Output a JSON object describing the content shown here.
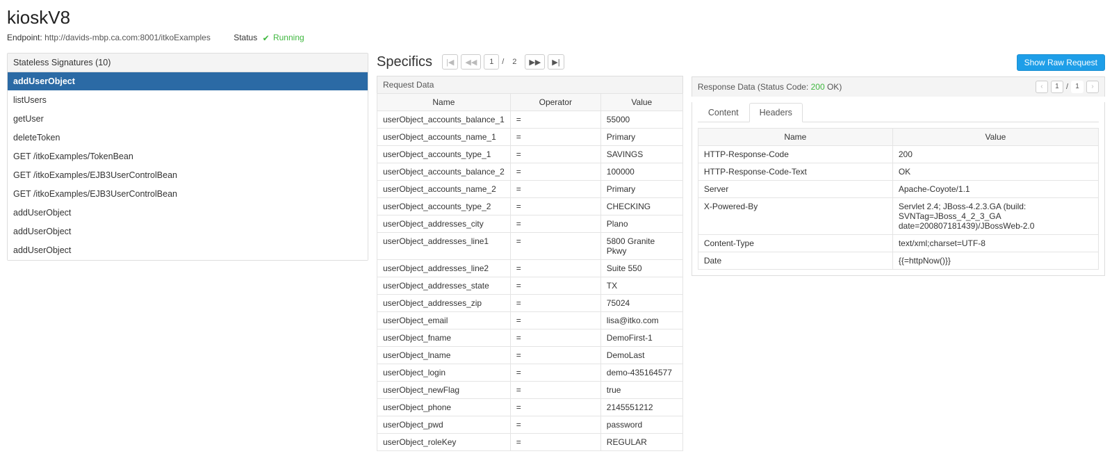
{
  "page_title": "kioskV8",
  "endpoint_label": "Endpoint:",
  "endpoint_value": "http://davids-mbp.ca.com:8001/itkoExamples",
  "status_label": "Status",
  "status_value": "Running",
  "signatures": {
    "header": "Stateless Signatures (10)",
    "items": [
      "addUserObject",
      "listUsers",
      "getUser",
      "deleteToken",
      "GET /itkoExamples/TokenBean",
      "GET /itkoExamples/EJB3UserControlBean",
      "GET /itkoExamples/EJB3UserControlBean",
      "addUserObject",
      "addUserObject",
      "addUserObject"
    ],
    "selected_index": 0
  },
  "specifics": {
    "title": "Specifics",
    "pager": {
      "current": "1",
      "total": "2"
    }
  },
  "raw_button": "Show Raw Request",
  "request": {
    "header": "Request Data",
    "columns": [
      "Name",
      "Operator",
      "Value"
    ],
    "rows": [
      {
        "name": "userObject_accounts_balance_1",
        "op": "=",
        "val": "55000"
      },
      {
        "name": "userObject_accounts_name_1",
        "op": "=",
        "val": "Primary"
      },
      {
        "name": "userObject_accounts_type_1",
        "op": "=",
        "val": "SAVINGS"
      },
      {
        "name": "userObject_accounts_balance_2",
        "op": "=",
        "val": "100000"
      },
      {
        "name": "userObject_accounts_name_2",
        "op": "=",
        "val": "Primary"
      },
      {
        "name": "userObject_accounts_type_2",
        "op": "=",
        "val": "CHECKING"
      },
      {
        "name": "userObject_addresses_city",
        "op": "=",
        "val": "Plano"
      },
      {
        "name": "userObject_addresses_line1",
        "op": "=",
        "val": "5800 Granite Pkwy"
      },
      {
        "name": "userObject_addresses_line2",
        "op": "=",
        "val": "Suite 550"
      },
      {
        "name": "userObject_addresses_state",
        "op": "=",
        "val": "TX"
      },
      {
        "name": "userObject_addresses_zip",
        "op": "=",
        "val": "75024"
      },
      {
        "name": "userObject_email",
        "op": "=",
        "val": "lisa@itko.com"
      },
      {
        "name": "userObject_fname",
        "op": "=",
        "val": "DemoFirst-1"
      },
      {
        "name": "userObject_lname",
        "op": "=",
        "val": "DemoLast"
      },
      {
        "name": "userObject_login",
        "op": "=",
        "val": "demo-435164577"
      },
      {
        "name": "userObject_newFlag",
        "op": "=",
        "val": "true"
      },
      {
        "name": "userObject_phone",
        "op": "=",
        "val": "2145551212"
      },
      {
        "name": "userObject_pwd",
        "op": "=",
        "val": "password"
      },
      {
        "name": "userObject_roleKey",
        "op": "=",
        "val": "REGULAR"
      }
    ]
  },
  "response": {
    "header_prefix": "Response Data (Status Code: ",
    "status_code": "200",
    "status_text": " OK)",
    "pager": {
      "current": "1",
      "total": "1"
    },
    "tabs": {
      "content": "Content",
      "headers": "Headers",
      "active": "Headers"
    },
    "columns": [
      "Name",
      "Value"
    ],
    "rows": [
      {
        "name": "HTTP-Response-Code",
        "val": "200"
      },
      {
        "name": "HTTP-Response-Code-Text",
        "val": "OK"
      },
      {
        "name": "Server",
        "val": "Apache-Coyote/1.1"
      },
      {
        "name": "X-Powered-By",
        "val": "Servlet 2.4; JBoss-4.2.3.GA (build: SVNTag=JBoss_4_2_3_GA date=200807181439)/JBossWeb-2.0"
      },
      {
        "name": "Content-Type",
        "val": "text/xml;charset=UTF-8"
      },
      {
        "name": "Date",
        "val": "{{=httpNow()}}"
      }
    ]
  },
  "icons": {
    "first": "|◀",
    "prev": "◀◀",
    "next": "▶▶",
    "last": "▶|",
    "prev1": "‹",
    "next1": "›",
    "check": "✔"
  }
}
